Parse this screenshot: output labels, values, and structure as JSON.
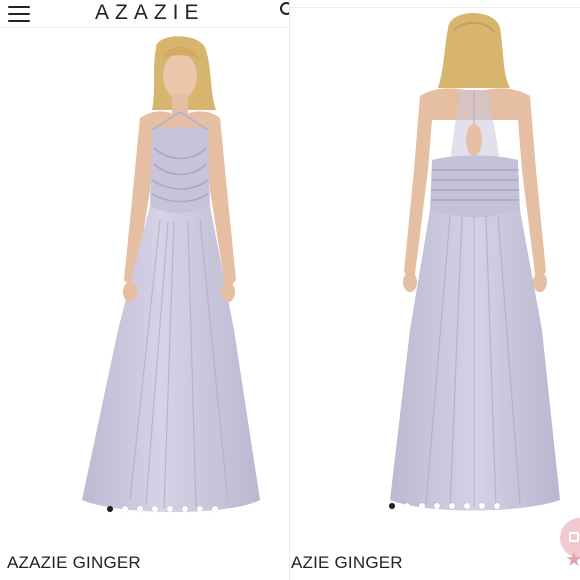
{
  "header": {
    "brand": "AZAZIE",
    "menu_icon": "hamburger-icon",
    "search_icon": "search-icon"
  },
  "left_panel": {
    "product_title": "AZAZIE GINGER",
    "image_view": "front",
    "carousel": {
      "total": 9,
      "active_index": 0
    }
  },
  "right_panel": {
    "product_title": "AZIE GINGER",
    "image_view": "back",
    "carousel": {
      "total": 9,
      "active_index": 0
    }
  },
  "colors": {
    "dress": "#c9c6dc",
    "dress_shadow": "#b3afcb",
    "dress_highlight": "#dcd9ea",
    "skin": "#e9c2a6",
    "hair": "#d9b873",
    "accent_pink": "#f2c9cf"
  },
  "floating": {
    "chat_icon": "chat-bubble-icon",
    "star_icon": "star-icon"
  }
}
